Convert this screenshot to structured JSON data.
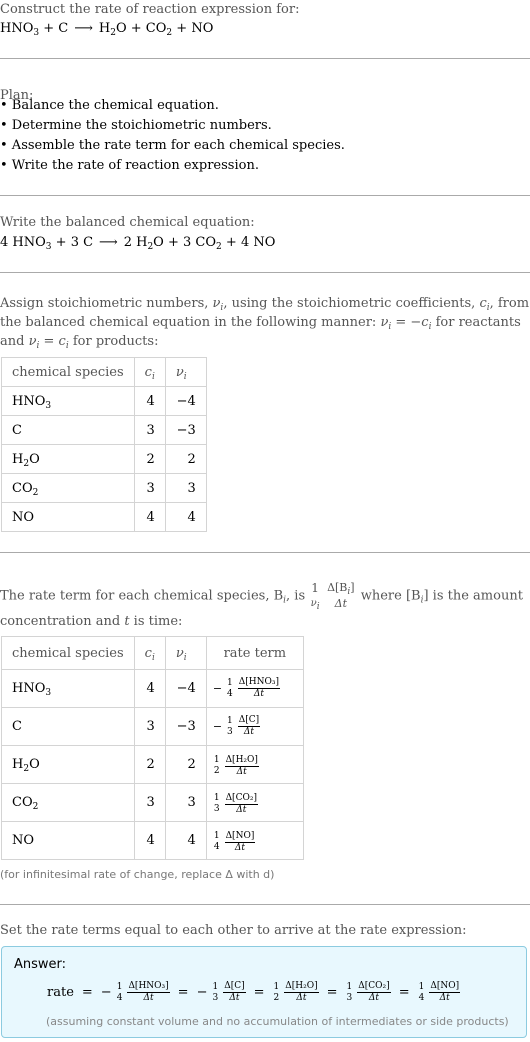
{
  "header": {
    "prompt": "Construct the rate of reaction expression for:",
    "equation": {
      "reactants": [
        {
          "coef": "",
          "base": "HNO",
          "sub": "3",
          "tail": ""
        },
        {
          "coef": "",
          "base": "C",
          "sub": "",
          "tail": ""
        }
      ],
      "products": [
        {
          "coef": "",
          "base": "H",
          "sub": "2",
          "tail": "O"
        },
        {
          "coef": "",
          "base": "CO",
          "sub": "2",
          "tail": ""
        },
        {
          "coef": "",
          "base": "NO",
          "sub": "",
          "tail": ""
        }
      ],
      "plus": "+",
      "arrow": "⟶"
    }
  },
  "plan": {
    "title": "Plan:",
    "bullet": "•",
    "items": [
      "Balance the chemical equation.",
      "Determine the stoichiometric numbers.",
      "Assemble the rate term for each chemical species.",
      "Write the rate of reaction expression."
    ]
  },
  "balanced": {
    "title": "Write the balanced chemical equation:",
    "reactants": [
      {
        "coef": "4",
        "base": "HNO",
        "sub": "3",
        "tail": ""
      },
      {
        "coef": "3",
        "base": "C",
        "sub": "",
        "tail": ""
      }
    ],
    "products": [
      {
        "coef": "2",
        "base": "H",
        "sub": "2",
        "tail": "O"
      },
      {
        "coef": "3",
        "base": "CO",
        "sub": "2",
        "tail": ""
      },
      {
        "coef": "4",
        "base": "NO",
        "sub": "",
        "tail": ""
      }
    ]
  },
  "stoich": {
    "text_line1_a": "Assign stoichiometric numbers, ",
    "nu_i": "ν",
    "c_i": "c",
    "i": "i",
    "text_line1_b": ", using the stoichiometric coefficients, ",
    "text_line1_c": ", from",
    "text_line2_a": "the balanced chemical equation in the following manner: ",
    "eq_react": " = −",
    "text_line2_b": " for reactants",
    "text_line3_a": "and ",
    "eq_prod": " = ",
    "text_line3_b": " for products:",
    "table": {
      "headers": [
        "chemical species",
        "c",
        "ν"
      ],
      "rows": [
        {
          "base": "HNO",
          "sub": "3",
          "tail": "",
          "c": "4",
          "nu": "−4"
        },
        {
          "base": "C",
          "sub": "",
          "tail": "",
          "c": "3",
          "nu": "−3"
        },
        {
          "base": "H",
          "sub": "2",
          "tail": "O",
          "c": "2",
          "nu": "2"
        },
        {
          "base": "CO",
          "sub": "2",
          "tail": "",
          "c": "3",
          "nu": "3"
        },
        {
          "base": "NO",
          "sub": "",
          "tail": "",
          "c": "4",
          "nu": "4"
        }
      ]
    }
  },
  "rateterm": {
    "text_a": "The rate term for each chemical species, B",
    "text_b": ", is ",
    "one": "1",
    "delta_b": "Δ[B",
    "close": "]",
    "delta_t": "Δt",
    "text_c": " where [B",
    "text_d": "] is the amount",
    "text_line2_a": "concentration and ",
    "t": "t",
    "text_line2_b": " is time:",
    "table": {
      "headers": [
        "chemical species",
        "c",
        "ν",
        "rate term"
      ],
      "rows": [
        {
          "base": "HNO",
          "sub": "3",
          "tail": "",
          "c": "4",
          "nu": "−4",
          "sign": "−",
          "den": "4",
          "conc": "HNO₃"
        },
        {
          "base": "C",
          "sub": "",
          "tail": "",
          "c": "3",
          "nu": "−3",
          "sign": "−",
          "den": "3",
          "conc": "C"
        },
        {
          "base": "H",
          "sub": "2",
          "tail": "O",
          "c": "2",
          "nu": "2",
          "sign": "",
          "den": "2",
          "conc": "H₂O"
        },
        {
          "base": "CO",
          "sub": "2",
          "tail": "",
          "c": "3",
          "nu": "3",
          "sign": "",
          "den": "3",
          "conc": "CO₂"
        },
        {
          "base": "NO",
          "sub": "",
          "tail": "",
          "c": "4",
          "nu": "4",
          "sign": "",
          "den": "4",
          "conc": "NO"
        }
      ]
    },
    "note": "(for infinitesimal rate of change, replace Δ with d)"
  },
  "final": {
    "title": "Set the rate terms equal to each other to arrive at the rate expression:",
    "answer_label": "Answer:",
    "rate_word": "rate",
    "equals": "=",
    "terms": [
      {
        "sign": "−",
        "den": "4",
        "conc": "HNO₃"
      },
      {
        "sign": "−",
        "den": "3",
        "conc": "C"
      },
      {
        "sign": "",
        "den": "2",
        "conc": "H₂O"
      },
      {
        "sign": "",
        "den": "3",
        "conc": "CO₂"
      },
      {
        "sign": "",
        "den": "4",
        "conc": "NO"
      }
    ],
    "assumption": "(assuming constant volume and no accumulation of intermediates or side products)"
  },
  "colors": {
    "answer_bg": "#e8f8fe",
    "answer_border": "#8ccbe0",
    "divider": "#aaaaaa",
    "muted_text": "#555555"
  }
}
